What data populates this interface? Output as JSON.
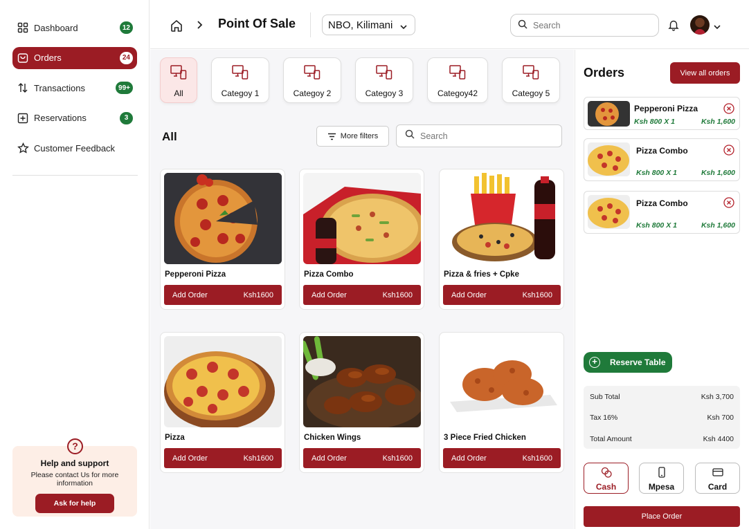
{
  "sidebar": {
    "items": [
      {
        "label": "Dashboard",
        "badge": "12",
        "icon": "grid-icon"
      },
      {
        "label": "Orders",
        "badge": "24",
        "icon": "bag-icon"
      },
      {
        "label": "Transactions",
        "badge": "99+",
        "icon": "transfer-icon"
      },
      {
        "label": "Reservations",
        "badge": "3",
        "icon": "plus-square-icon"
      },
      {
        "label": "Customer Feedback",
        "badge": "",
        "icon": "star-icon"
      }
    ],
    "help": {
      "title": "Help and support",
      "text": "Please contact Us for more information",
      "button": "Ask for help"
    }
  },
  "header": {
    "title": "Point Of Sale",
    "location": "NBO, Kilimani",
    "search_placeholder": "Search"
  },
  "main": {
    "categories": [
      "All",
      "Categoy 1",
      "Categoy 2",
      "Categoy 3",
      "Categoy42",
      "Categoy 5"
    ],
    "section_title": "All",
    "more_filters": "More filters",
    "search_placeholder": "Search",
    "add_label": "Add Order",
    "products": [
      {
        "name": "Pepperoni Pizza",
        "price": "Ksh1600"
      },
      {
        "name": "Pizza Combo",
        "price": "Ksh1600"
      },
      {
        "name": "Pizza & fries + Cpke",
        "price": "Ksh1600"
      },
      {
        "name": "Pizza",
        "price": "Ksh1600"
      },
      {
        "name": "Chicken Wings",
        "price": "Ksh1600"
      },
      {
        "name": "3 Piece Fried Chicken",
        "price": "Ksh1600"
      }
    ]
  },
  "orders_panel": {
    "title": "Orders",
    "view_all": "View all orders",
    "items": [
      {
        "name": "Pepperoni Pizza",
        "qty": "Ksh 800 X 1",
        "total": "Ksh 1,600"
      },
      {
        "name": "Pizza Combo",
        "qty": "Ksh 800 X 1",
        "total": "Ksh 1,600"
      },
      {
        "name": "Pizza Combo",
        "qty": "Ksh 800 X 1",
        "total": "Ksh 1,600"
      }
    ],
    "reserve": "Reserve Table",
    "summary": {
      "subtotal_label": "Sub Total",
      "subtotal": "Ksh 3,700",
      "tax_label": "Tax 16%",
      "tax": "Ksh 700",
      "total_label": "Total Amount",
      "total": "Ksh 4400"
    },
    "payment": [
      "Cash",
      "Mpesa",
      "Card"
    ],
    "place_order": "Place Order"
  },
  "colors": {
    "brand": "#9b1c24",
    "success": "#1f7a3a"
  }
}
